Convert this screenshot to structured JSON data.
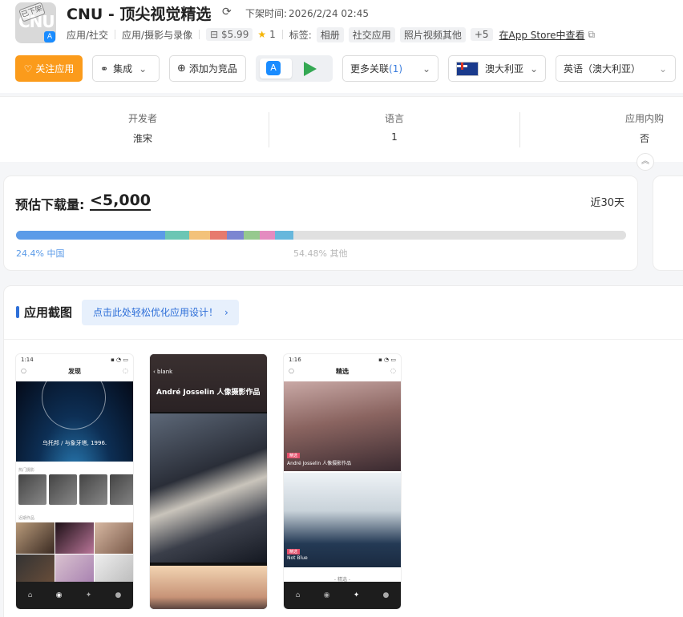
{
  "app": {
    "icon_text": "CNU",
    "icon_stamp": "已下架",
    "title": "CNU - 顶尖视觉精选",
    "release_label": "下架时间:",
    "release_time": "2026/2/24 02:45",
    "category_primary": "应用/社交",
    "category_secondary": "应用/摄影与录像",
    "price": "$5.99",
    "rating": "1",
    "tags_label": "标签:",
    "tags": [
      "相册",
      "社交应用",
      "照片视频其他"
    ],
    "tags_more": "+5",
    "store_link": "在App Store中查看"
  },
  "toolbar": {
    "follow_label": "关注应用",
    "integrate_label": "集成",
    "compete_label": "添加为竞品",
    "more_label": "更多关联",
    "more_count": "(1)",
    "country": "澳大利亚",
    "language": "英语（澳大利亚）"
  },
  "info": {
    "developer_label": "开发者",
    "developer_value": "淮宋",
    "language_label": "语言",
    "language_value": "1",
    "iap_label": "应用内购",
    "iap_value": "否"
  },
  "downloads": {
    "title": "预估下载量:",
    "value": "<5,000",
    "period": "近30天",
    "segments": [
      {
        "name": "中国",
        "percent": 24.4,
        "color": "#5b9be8"
      },
      {
        "name": "",
        "percent": 4.0,
        "color": "#6cc6b4"
      },
      {
        "name": "",
        "percent": 3.4,
        "color": "#f3c27a"
      },
      {
        "name": "",
        "percent": 2.8,
        "color": "#e77a6e"
      },
      {
        "name": "",
        "percent": 2.7,
        "color": "#7c86d1"
      },
      {
        "name": "",
        "percent": 2.6,
        "color": "#96c98e"
      },
      {
        "name": "",
        "percent": 2.5,
        "color": "#e48bc0"
      },
      {
        "name": "",
        "percent": 3.1,
        "color": "#67b7dc"
      },
      {
        "name": "其他",
        "percent": 54.48,
        "color": "#e0e0e0"
      }
    ],
    "china_label": "24.4% 中国",
    "other_label": "54.48% 其他"
  },
  "screenshots": {
    "title": "应用截图",
    "promo": "点击此处轻松优化应用设计！",
    "p1": {
      "time": "1:14",
      "title": "发现",
      "caption": "乌托邦 / 与象牙塔, 1996.",
      "sec1": "热门摄影",
      "sec2": "近期作品"
    },
    "p2": {
      "back": "blank",
      "title": "André Josselin  人像摄影作品"
    },
    "p3": {
      "time": "1:16",
      "title": "精选",
      "tag1": "精选",
      "cap1": "André Josselin 人像摄影作品",
      "tag2": "精选",
      "cap2": "Not Blue",
      "foot": "- 精选 -"
    }
  }
}
